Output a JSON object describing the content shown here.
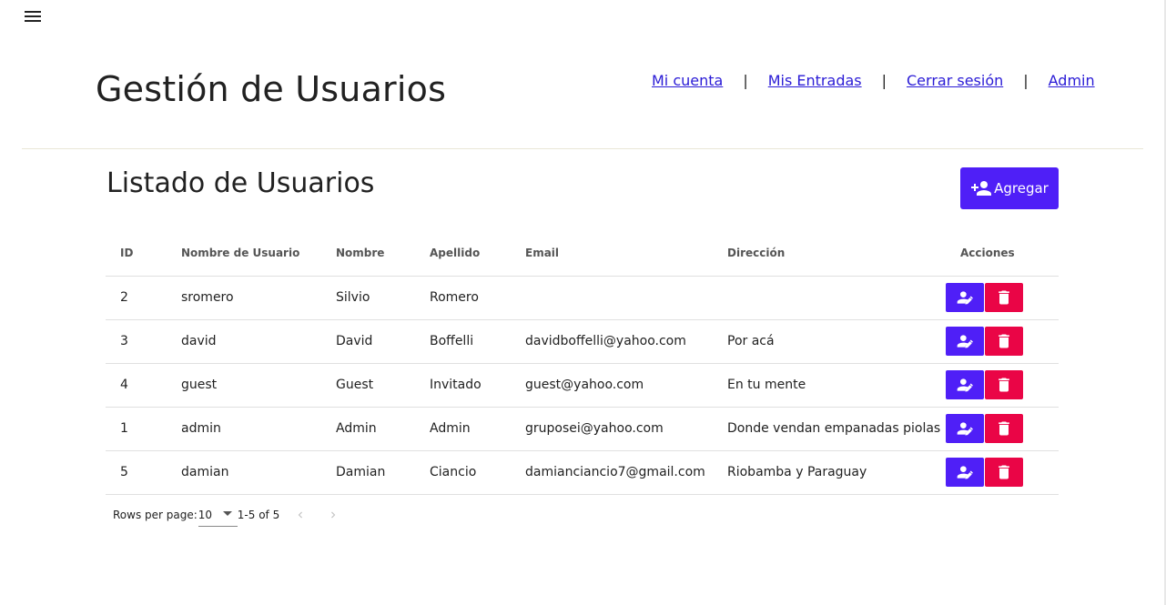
{
  "header": {
    "title": "Gestión de Usuarios",
    "nav": [
      {
        "label": "Mi cuenta"
      },
      {
        "label": "Mis Entradas"
      },
      {
        "label": "Cerrar sesión"
      },
      {
        "label": "Admin"
      }
    ],
    "separator": "|"
  },
  "section": {
    "title": "Listado de Usuarios",
    "add_button": {
      "label": "Agregar",
      "icon": "person-add-icon"
    }
  },
  "table": {
    "columns": [
      "ID",
      "Nombre de Usuario",
      "Nombre",
      "Apellido",
      "Email",
      "Dirección",
      "Acciones"
    ],
    "rows": [
      {
        "id": "2",
        "username": "sromero",
        "nombre": "Silvio",
        "apellido": "Romero",
        "email": "",
        "direccion": ""
      },
      {
        "id": "3",
        "username": "david",
        "nombre": "David",
        "apellido": "Boffelli",
        "email": "davidboffelli@yahoo.com",
        "direccion": "Por acá"
      },
      {
        "id": "4",
        "username": "guest",
        "nombre": "Guest",
        "apellido": "Invitado",
        "email": "guest@yahoo.com",
        "direccion": "En tu mente"
      },
      {
        "id": "1",
        "username": "admin",
        "nombre": "Admin",
        "apellido": "Admin",
        "email": "gruposei@yahoo.com",
        "direccion": "Donde vendan empanadas piolas"
      },
      {
        "id": "5",
        "username": "damian",
        "nombre": "Damian",
        "apellido": "Ciancio",
        "email": "damianciancio7@gmail.com",
        "direccion": "Riobamba y Paraguay"
      }
    ],
    "action_icons": {
      "edit": "person-edit-icon",
      "delete": "trash-icon"
    }
  },
  "pagination": {
    "rows_per_page_label": "Rows per page:",
    "rows_per_page_value": "10",
    "range": "1-5 of 5"
  },
  "colors": {
    "primary": "#4f1ff7",
    "danger": "#ea0546",
    "link": "#2a1bd6"
  }
}
